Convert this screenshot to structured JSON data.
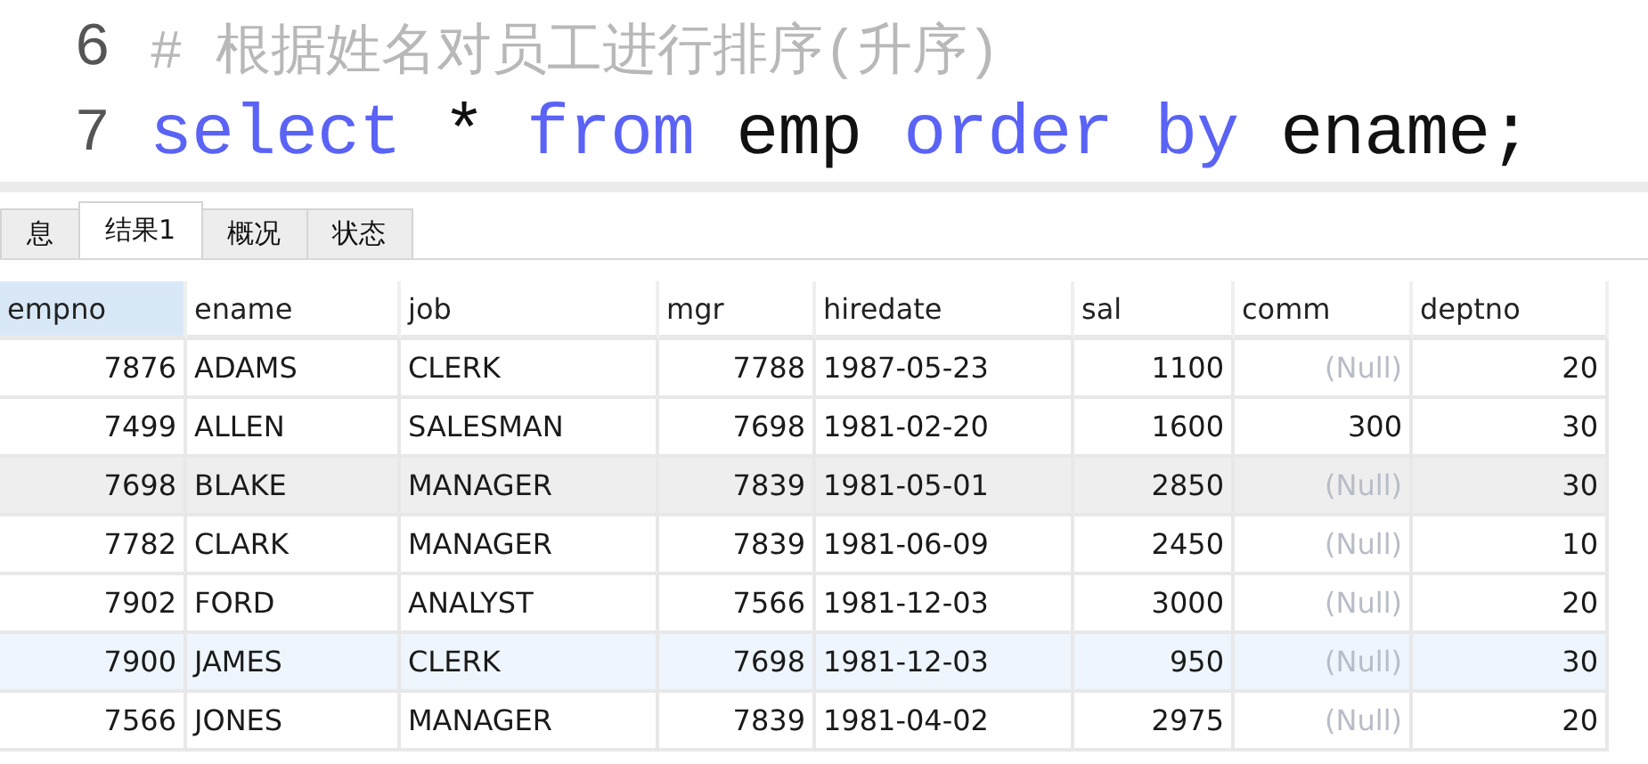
{
  "editor": {
    "lines": [
      {
        "number": "6",
        "tokens": [
          {
            "text": "# 根据姓名对员工进行排序(升序)",
            "kind": "comment"
          }
        ]
      },
      {
        "number": "7",
        "tokens": [
          {
            "text": "select",
            "kind": "keyword"
          },
          {
            "text": " * ",
            "kind": "plain"
          },
          {
            "text": "from",
            "kind": "keyword"
          },
          {
            "text": " emp ",
            "kind": "plain"
          },
          {
            "text": "order by",
            "kind": "keyword"
          },
          {
            "text": " ename;",
            "kind": "plain"
          }
        ]
      }
    ]
  },
  "tabs": [
    {
      "label": "息",
      "selected": false
    },
    {
      "label": "结果1",
      "selected": true
    },
    {
      "label": "概况",
      "selected": false
    },
    {
      "label": "状态",
      "selected": false
    }
  ],
  "table": {
    "columns": [
      {
        "label": "empno",
        "kind": "number",
        "selected": true
      },
      {
        "label": "ename",
        "kind": "text",
        "selected": false
      },
      {
        "label": "job",
        "kind": "text",
        "selected": false
      },
      {
        "label": "mgr",
        "kind": "number",
        "selected": false
      },
      {
        "label": "hiredate",
        "kind": "text",
        "selected": false
      },
      {
        "label": "sal",
        "kind": "number",
        "selected": false
      },
      {
        "label": "comm",
        "kind": "number",
        "selected": false
      },
      {
        "label": "deptno",
        "kind": "number",
        "selected": false
      }
    ],
    "rows": [
      {
        "selected": false,
        "shaded": false,
        "cells": [
          "7876",
          "ADAMS",
          "CLERK",
          "7788",
          "1987-05-23",
          "1100",
          {
            "text": "(Null)",
            "kind": "null"
          },
          "20"
        ]
      },
      {
        "selected": false,
        "shaded": false,
        "cells": [
          "7499",
          "ALLEN",
          "SALESMAN",
          "7698",
          "1981-02-20",
          "1600",
          "300",
          "30"
        ]
      },
      {
        "selected": false,
        "shaded": true,
        "cells": [
          "7698",
          "BLAKE",
          "MANAGER",
          "7839",
          "1981-05-01",
          "2850",
          {
            "text": "(Null)",
            "kind": "null"
          },
          "30"
        ]
      },
      {
        "selected": false,
        "shaded": false,
        "cells": [
          "7782",
          "CLARK",
          "MANAGER",
          "7839",
          "1981-06-09",
          "2450",
          {
            "text": "(Null)",
            "kind": "null"
          },
          "10"
        ]
      },
      {
        "selected": false,
        "shaded": false,
        "cells": [
          "7902",
          "FORD",
          "ANALYST",
          "7566",
          "1981-12-03",
          "3000",
          {
            "text": "(Null)",
            "kind": "null"
          },
          "20"
        ]
      },
      {
        "selected": true,
        "shaded": false,
        "cells": [
          "7900",
          "JAMES",
          "CLERK",
          "7698",
          "1981-12-03",
          "950",
          {
            "text": "(Null)",
            "kind": "null"
          },
          "30"
        ]
      },
      {
        "selected": false,
        "shaded": false,
        "cells": [
          "7566",
          "JONES",
          "MANAGER",
          "7839",
          "1981-04-02",
          "2975",
          {
            "text": "(Null)",
            "kind": "null"
          },
          "20"
        ]
      }
    ]
  }
}
